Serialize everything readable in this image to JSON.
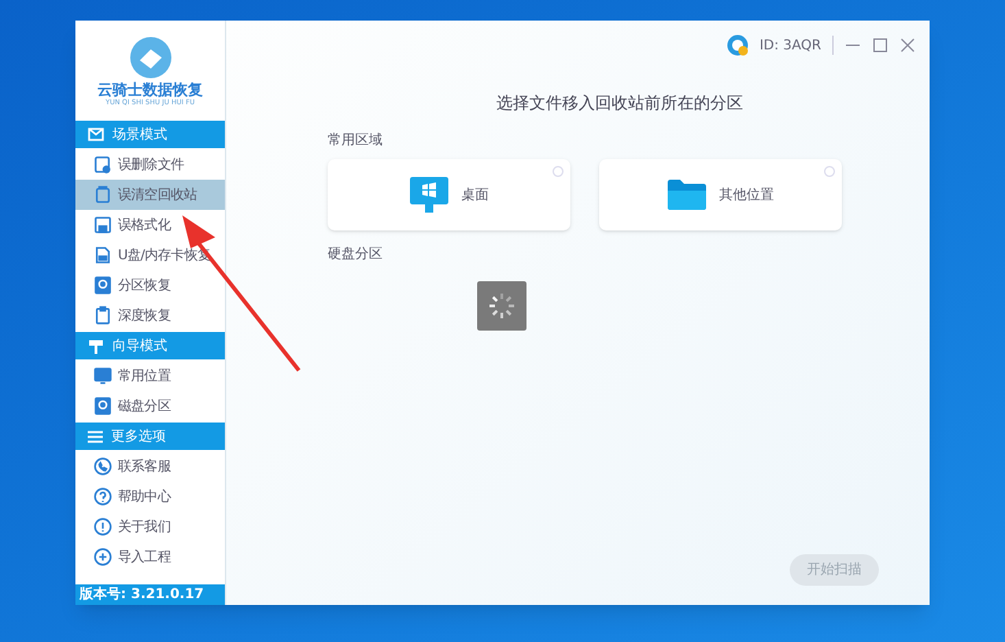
{
  "app": {
    "name": "云骑士数据恢复",
    "subtitle": "YUN QI SHI SHU JU HUI FU",
    "version": "版本号: 3.21.0.17"
  },
  "sidebar": {
    "sections": [
      {
        "title": "场景模式",
        "items": [
          {
            "label": "误删除文件",
            "selected": false
          },
          {
            "label": "误清空回收站",
            "selected": true
          },
          {
            "label": "误格式化",
            "selected": false
          },
          {
            "label": "U盘/内存卡恢复",
            "selected": false
          },
          {
            "label": "分区恢复",
            "selected": false
          },
          {
            "label": "深度恢复",
            "selected": false
          }
        ]
      },
      {
        "title": "向导模式",
        "items": [
          {
            "label": "常用位置",
            "selected": false
          },
          {
            "label": "磁盘分区",
            "selected": false
          }
        ]
      },
      {
        "title": "更多选项",
        "items": [
          {
            "label": "联系客服",
            "selected": false
          },
          {
            "label": "帮助中心",
            "selected": false
          },
          {
            "label": "关于我们",
            "selected": false
          },
          {
            "label": "导入工程",
            "selected": false
          }
        ]
      }
    ]
  },
  "header": {
    "user_id": "ID: 3AQR"
  },
  "main": {
    "title": "选择文件移入回收站前所在的分区",
    "common_heading": "常用区域",
    "locations": [
      {
        "label": "桌面",
        "kind": "desktop",
        "selected": false
      },
      {
        "label": "其他位置",
        "kind": "folder",
        "selected": false
      }
    ],
    "disk_heading": "硬盘分区",
    "loading": true,
    "start_button": {
      "label": "开始扫描",
      "disabled": true
    }
  }
}
